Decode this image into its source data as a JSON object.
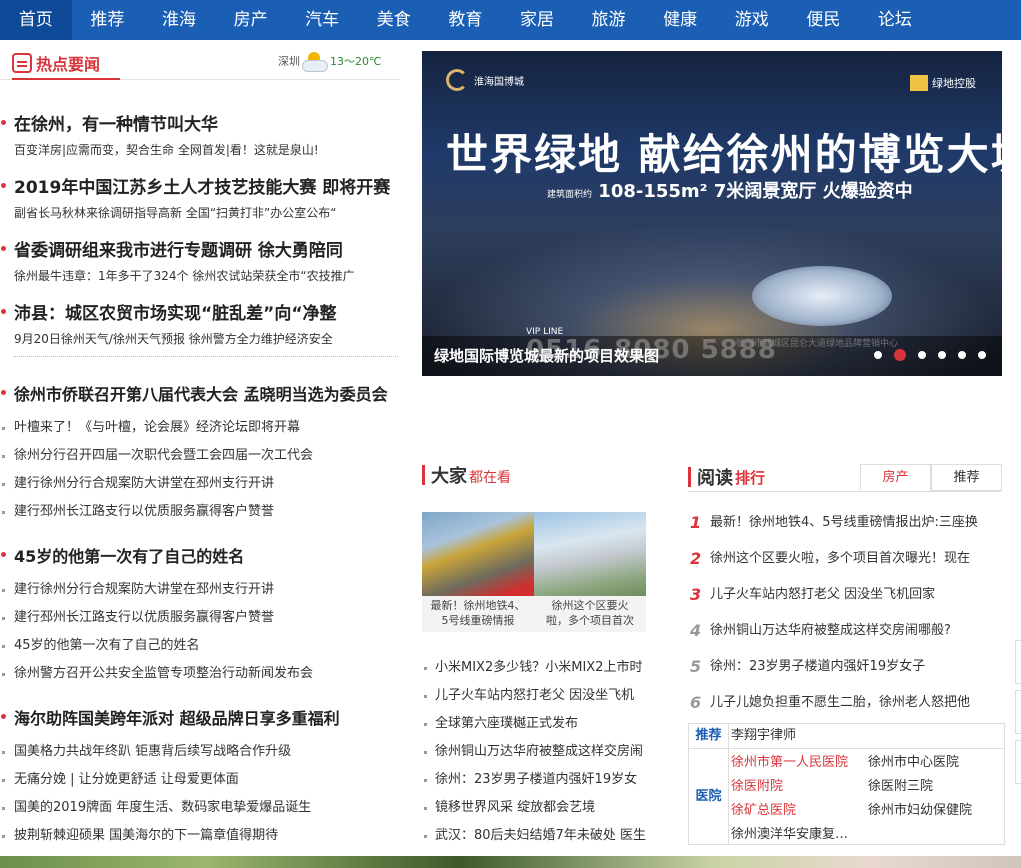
{
  "nav": [
    "首页",
    "推荐",
    "淮海",
    "房产",
    "汽车",
    "美食",
    "教育",
    "家居",
    "旅游",
    "健康",
    "游戏",
    "便民",
    "论坛"
  ],
  "hot": {
    "title": "热点要闻",
    "weather": {
      "city": "深圳",
      "temp": "13～20℃"
    }
  },
  "headlines": [
    {
      "title": "在徐州，有一种情节叫大华",
      "sub": "百变洋房|应需而变，契合生命  全网首发|看！这就是泉山!"
    },
    {
      "title": "2019年中国江苏乡土人才技艺技能大赛 即将开赛",
      "sub": "副省长马秋林来徐调研指导高新  全国“扫黄打非”办公室公布“"
    },
    {
      "title": "省委调研组来我市进行专题调研 徐大勇陪同",
      "sub": "徐州最牛违章：1年多干了324个  徐州农试站荣获全市“农技推广"
    },
    {
      "title": "沛县：城区农贸市场实现“脏乱差”向“净整",
      "sub": "9月20日徐州天气/徐州天气预报  徐州警方全力维护经济安全"
    }
  ],
  "blocks": [
    {
      "title": "徐州市侨联召开第八届代表大会 孟晓明当选为委员会",
      "items": [
        "叶檀来了！《与叶檀，论会展》经济论坛即将开幕",
        "徐州分行召开四届一次职代会暨工会四届一次工代会",
        "建行徐州分行合规案防大讲堂在邳州支行开讲",
        "建行邳州长江路支行以优质服务赢得客户赞誉"
      ]
    },
    {
      "title": "45岁的他第一次有了自己的姓名",
      "items": [
        "建行徐州分行合规案防大讲堂在邳州支行开讲",
        "建行邳州长江路支行以优质服务赢得客户赞誉",
        "45岁的他第一次有了自己的姓名",
        "徐州警方召开公共安全监管专项整治行动新闻发布会"
      ]
    },
    {
      "title": "海尔助阵国美跨年派对 超级品牌日享多重福利",
      "items": [
        "国美格力共战年终趴 钜惠背后续写战略合作升级",
        "无痛分娩 | 让分娩更舒适 让母爱更体面",
        "国美的2019牌面 年度生活、数码家电挚爱爆品诞生",
        "披荆斩棘迎硕果 国美海尔的下一篇章值得期待"
      ]
    }
  ],
  "banner": {
    "logo_left": "淮海国博城",
    "logo_right": "绿地控股",
    "headline": "世界绿地  献给徐州的博览大城",
    "spec_prefix": "建筑面积约",
    "spec": "108-155m²   7米阔景宽厅   火爆验资中",
    "vip": "VIP LINE",
    "phone": "0516-8080 5888",
    "addr": "徐州市新城区昆仑大道绿地品牌营销中心",
    "caption": "绿地国际博览城最新的项目效果图",
    "slides": 6,
    "active_slide": 2
  },
  "dajia": {
    "title": "大家",
    "title_suffix": "都在看",
    "thumbs": [
      {
        "caption": "最新！徐州地铁4、5号线重磅情报"
      },
      {
        "caption": "徐州这个区要火啦，多个项目首次"
      }
    ],
    "list": [
      "小米MIX2多少钱？小米MIX2上市时",
      "儿子火车站内怒打老父 因没坐飞机",
      "全球第六座璞樾正式发布",
      "徐州铜山万达华府被整成这样交房闹",
      "徐州：23岁男子楼道内强奸19岁女",
      "镜移世界风采 绽放都会艺境",
      "武汉：80后夫妇结婚7年未破处 医生"
    ]
  },
  "yuedu": {
    "title": "阅读",
    "title_suffix": "排行",
    "tabs": [
      "房产",
      "推荐"
    ],
    "rank": [
      {
        "n": "1",
        "text": "最新！徐州地铁4、5号线重磅情报出炉:三座换"
      },
      {
        "n": "2",
        "text": "徐州这个区要火啦，多个项目首次曝光！现在"
      },
      {
        "n": "3",
        "text": "儿子火车站内怒打老父 因没坐飞机回家"
      },
      {
        "n": "4",
        "text": "徐州铜山万达华府被整成这样交房闹哪般?"
      },
      {
        "n": "5",
        "text": "徐州：23岁男子楼道内强奸19岁女子"
      },
      {
        "n": "6",
        "text": "儿子儿媳负担重不愿生二胎，徐州老人怒把他"
      }
    ],
    "rec": {
      "label1": "推荐",
      "lawyer": "李翔宇律师",
      "label2": "医院",
      "hospitals": [
        "徐州市第一人民医院",
        "徐州市中心医院",
        "徐医附院",
        "徐医附三院",
        "徐矿总医院",
        "徐州市妇幼保健院",
        "徐州澳洋华安康复…"
      ]
    }
  }
}
